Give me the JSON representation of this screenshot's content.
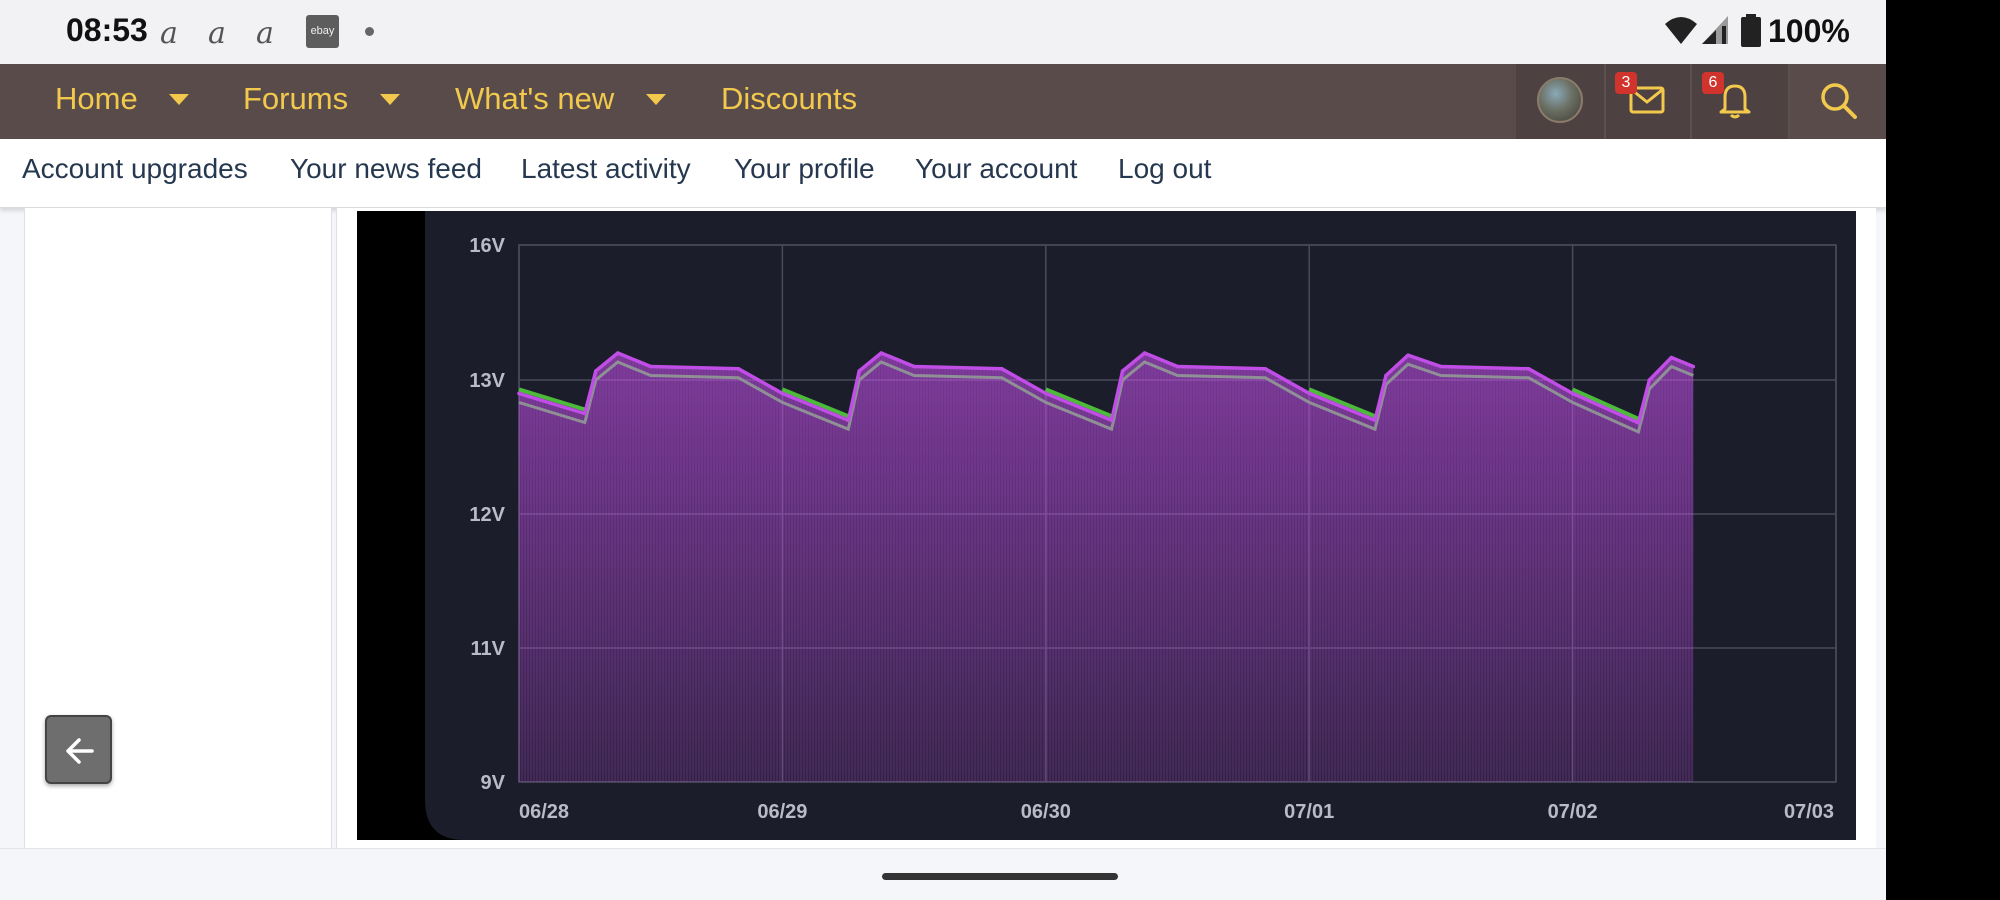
{
  "status_bar": {
    "time": "08:53",
    "notification_icons": [
      "a",
      "a",
      "a"
    ],
    "ebay_label": "ebay",
    "battery": "100%"
  },
  "main_nav": {
    "items": [
      {
        "label": "Home",
        "has_dropdown": true
      },
      {
        "label": "Forums",
        "has_dropdown": true
      },
      {
        "label": "What's new",
        "has_dropdown": true
      },
      {
        "label": "Discounts",
        "has_dropdown": false
      }
    ],
    "inbox_count": "3",
    "alerts_count": "6"
  },
  "sub_nav": {
    "items": [
      "Account upgrades",
      "Your news feed",
      "Latest activity",
      "Your profile",
      "Your account",
      "Log out"
    ]
  },
  "colors": {
    "nav_bg": "#5a4b4b",
    "nav_text": "#f2c94c",
    "subnav_text": "#26384f",
    "chart_bg": "#1c1d2b",
    "series_main": "#c04ee6",
    "series_gray": "#8f8f96",
    "series_green": "#4cbb3a"
  },
  "chart_data": {
    "type": "line",
    "y_ticks": [
      "16V",
      "13V",
      "12V",
      "11V",
      "9V"
    ],
    "x_ticks": [
      "06/28",
      "06/29",
      "06/30",
      "07/01",
      "07/02",
      "07/03"
    ],
    "grid": true,
    "series": [
      {
        "color": "#c04ee6",
        "points": [
          [
            "06/28 00:00",
            12.9
          ],
          [
            "06/28 06:00",
            12.75
          ],
          [
            "06/28 07:00",
            13.2
          ],
          [
            "06/28 09:00",
            13.6
          ],
          [
            "06/28 12:00",
            13.3
          ],
          [
            "06/28 20:00",
            13.25
          ],
          [
            "06/29 00:00",
            12.9
          ],
          [
            "06/29 06:00",
            12.7
          ],
          [
            "06/29 07:00",
            13.2
          ],
          [
            "06/29 09:00",
            13.6
          ],
          [
            "06/29 12:00",
            13.3
          ],
          [
            "06/29 20:00",
            13.25
          ],
          [
            "06/30 00:00",
            12.9
          ],
          [
            "06/30 06:00",
            12.7
          ],
          [
            "06/30 07:00",
            13.2
          ],
          [
            "06/30 09:00",
            13.6
          ],
          [
            "06/30 12:00",
            13.3
          ],
          [
            "06/30 20:00",
            13.25
          ],
          [
            "07/01 00:00",
            12.9
          ],
          [
            "07/01 06:00",
            12.7
          ],
          [
            "07/01 07:00",
            13.1
          ],
          [
            "07/01 09:00",
            13.55
          ],
          [
            "07/01 12:00",
            13.3
          ],
          [
            "07/01 20:00",
            13.25
          ],
          [
            "07/02 00:00",
            12.9
          ],
          [
            "07/02 06:00",
            12.68
          ],
          [
            "07/02 07:00",
            13.0
          ],
          [
            "07/02 09:00",
            13.5
          ],
          [
            "07/02 11:00",
            13.3
          ]
        ]
      }
    ]
  },
  "back_button_label": "back"
}
